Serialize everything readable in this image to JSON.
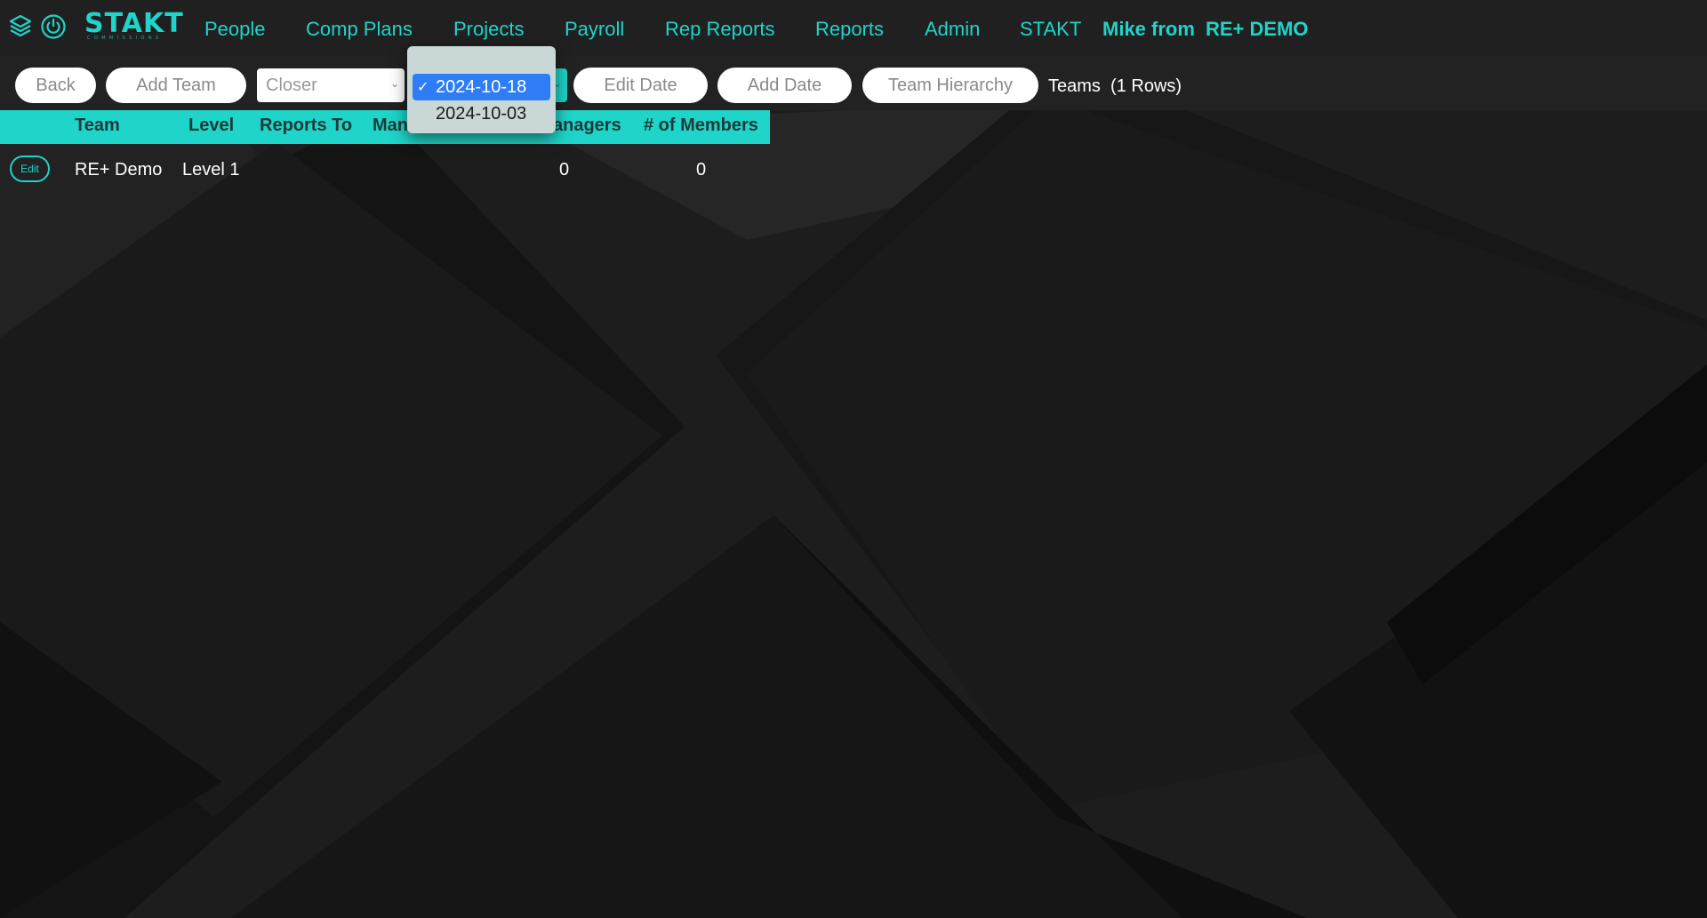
{
  "brand": {
    "name": "STAKT",
    "subtitle": "COMMISSIONS",
    "accent_color": "#1fd4c8",
    "icons": [
      "layers-icon",
      "power-icon"
    ]
  },
  "nav": {
    "links": [
      "People",
      "Comp Plans",
      "Projects",
      "Payroll",
      "Rep Reports",
      "Reports",
      "Admin",
      "STAKT"
    ],
    "user_label": "Mike from",
    "company_label": "RE+ DEMO"
  },
  "toolbar": {
    "back_label": "Back",
    "add_team_label": "Add Team",
    "role_select_value": "Closer",
    "edit_date_label": "Edit Date",
    "add_date_label": "Add Date",
    "team_hierarchy_label": "Team Hierarchy",
    "teams_title": "Teams",
    "rows_count": "(1 Rows)"
  },
  "date_dropdown": {
    "options": [
      "2024-10-18",
      "2024-10-03"
    ],
    "selected": "2024-10-18",
    "check": "✓"
  },
  "table": {
    "headers": [
      "Team",
      "Level",
      "Reports To",
      "Man",
      "anagers",
      "# of Members"
    ],
    "rows": [
      {
        "edit_label": "Edit",
        "team": "RE+ Demo",
        "level": "Level 1",
        "managers": "0",
        "members": "0"
      }
    ]
  }
}
